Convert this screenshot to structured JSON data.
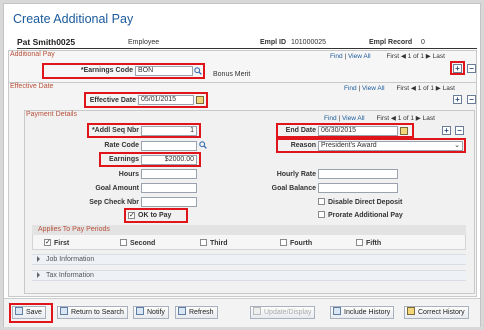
{
  "page_title": "Create Additional Pay",
  "employee": {
    "name": "Pat Smith0025",
    "role": "Employee",
    "empl_id_label": "Empl ID",
    "empl_id": "101000025",
    "empl_record_label": "Empl Record",
    "empl_record": "0"
  },
  "additional_pay": {
    "title": "Additional Pay",
    "nav_find": "Find",
    "nav_view_all": "View All",
    "nav_first": "First",
    "nav_count": "1 of 1",
    "nav_last": "Last",
    "earnings_code_label": "*Earnings Code",
    "earnings_code_value": "BON",
    "earnings_code_desc": "Bonus Merit"
  },
  "effective_date": {
    "title": "Effective Date",
    "nav_find": "Find",
    "nav_view_all": "View All",
    "nav_first": "First",
    "nav_count": "1 of 1",
    "nav_last": "Last",
    "label": "Effective Date",
    "value": "05/01/2015"
  },
  "payment_details": {
    "title": "Payment Details",
    "nav_find": "Find",
    "nav_view_all": "View All",
    "nav_first": "First",
    "nav_count": "1 of 1",
    "nav_last": "Last",
    "addl_seq_label": "*Addl Seq Nbr",
    "addl_seq_value": "1",
    "end_date_label": "End Date",
    "end_date_value": "06/30/2015",
    "rate_code_label": "Rate Code",
    "rate_code_value": "",
    "reason_label": "Reason",
    "reason_value": "President's Award",
    "earnings_label": "Earnings",
    "earnings_value": "$2000.00",
    "hours_label": "Hours",
    "hours_value": "",
    "hourly_rate_label": "Hourly Rate",
    "hourly_rate_value": "",
    "goal_amount_label": "Goal Amount",
    "goal_amount_value": "",
    "goal_balance_label": "Goal Balance",
    "goal_balance_value": "",
    "sep_check_label": "Sep Check Nbr",
    "sep_check_value": "",
    "disable_direct_deposit": "Disable Direct Deposit",
    "prorate_additional_pay": "Prorate Additional Pay",
    "ok_to_pay": "OK to Pay"
  },
  "applies_to_pay_periods": {
    "title": "Applies To Pay Periods",
    "first": "First",
    "second": "Second",
    "third": "Third",
    "fourth": "Fourth",
    "fifth": "Fifth"
  },
  "job_information": "Job Information",
  "tax_information": "Tax Information",
  "toolbar": {
    "save": "Save",
    "return_to_search": "Return to Search",
    "notify": "Notify",
    "refresh": "Refresh",
    "update_display": "Update/Display",
    "include_history": "Include History",
    "correct_history": "Correct History"
  }
}
